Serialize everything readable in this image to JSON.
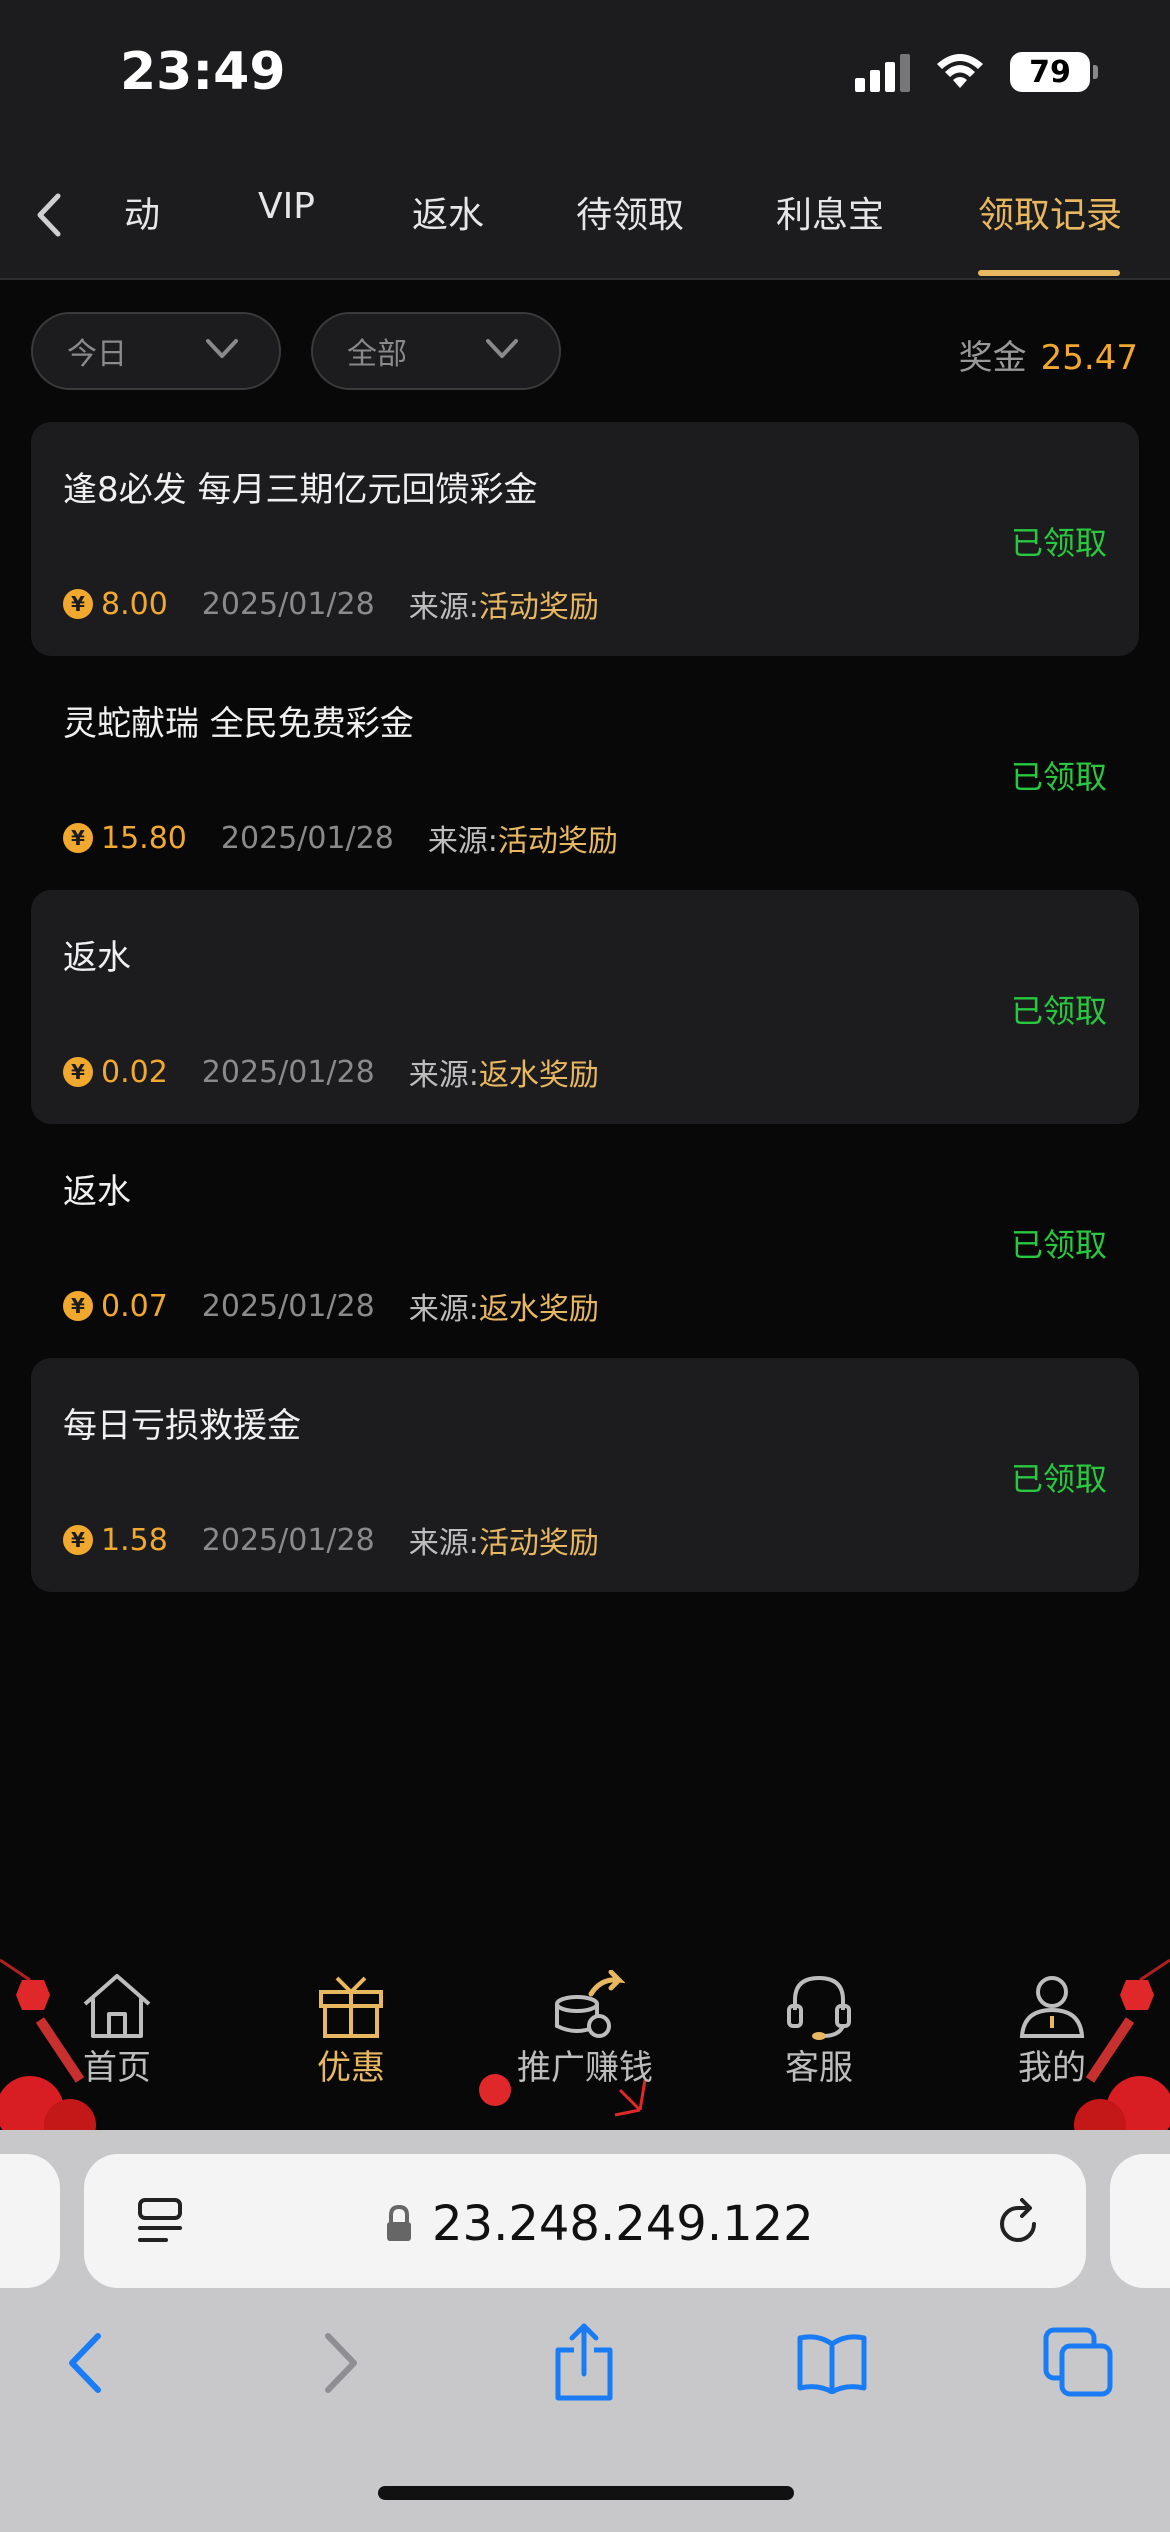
{
  "status_bar": {
    "time": "23:49",
    "battery": "79"
  },
  "tabs": [
    {
      "label": "动",
      "active": false
    },
    {
      "label": "VIP",
      "active": false
    },
    {
      "label": "返水",
      "active": false
    },
    {
      "label": "待领取",
      "active": false
    },
    {
      "label": "利息宝",
      "active": false
    },
    {
      "label": "领取记录",
      "active": true
    }
  ],
  "filters": {
    "date": "今日",
    "type": "全部"
  },
  "bonus": {
    "label": "奖金",
    "amount": "25.47"
  },
  "records": [
    {
      "title": "逢8必发 每月三期亿元回馈彩金",
      "status": "已领取",
      "coin": "¥",
      "amount": "8.00",
      "date": "2025/01/28",
      "source_label": "来源:",
      "source": "活动奖励"
    },
    {
      "title": "灵蛇献瑞 全民免费彩金",
      "status": "已领取",
      "coin": "¥",
      "amount": "15.80",
      "date": "2025/01/28",
      "source_label": "来源:",
      "source": "活动奖励"
    },
    {
      "title": "返水",
      "status": "已领取",
      "coin": "¥",
      "amount": "0.02",
      "date": "2025/01/28",
      "source_label": "来源:",
      "source": "返水奖励"
    },
    {
      "title": "返水",
      "status": "已领取",
      "coin": "¥",
      "amount": "0.07",
      "date": "2025/01/28",
      "source_label": "来源:",
      "source": "返水奖励"
    },
    {
      "title": "每日亏损救援金",
      "status": "已领取",
      "coin": "¥",
      "amount": "1.58",
      "date": "2025/01/28",
      "source_label": "来源:",
      "source": "活动奖励"
    }
  ],
  "bottom_nav": [
    {
      "label": "首页",
      "icon": "home-icon",
      "active": false
    },
    {
      "label": "优惠",
      "icon": "gift-icon",
      "active": true
    },
    {
      "label": "推广赚钱",
      "icon": "coins-share-icon",
      "active": false
    },
    {
      "label": "客服",
      "icon": "headset-icon",
      "active": false
    },
    {
      "label": "我的",
      "icon": "user-icon",
      "active": false
    }
  ],
  "browser": {
    "url": "23.248.249.122"
  },
  "colors": {
    "accent": "#e8b860",
    "amount": "#f0a92e",
    "claimed": "#28c840",
    "card": "#1c1c1e"
  }
}
